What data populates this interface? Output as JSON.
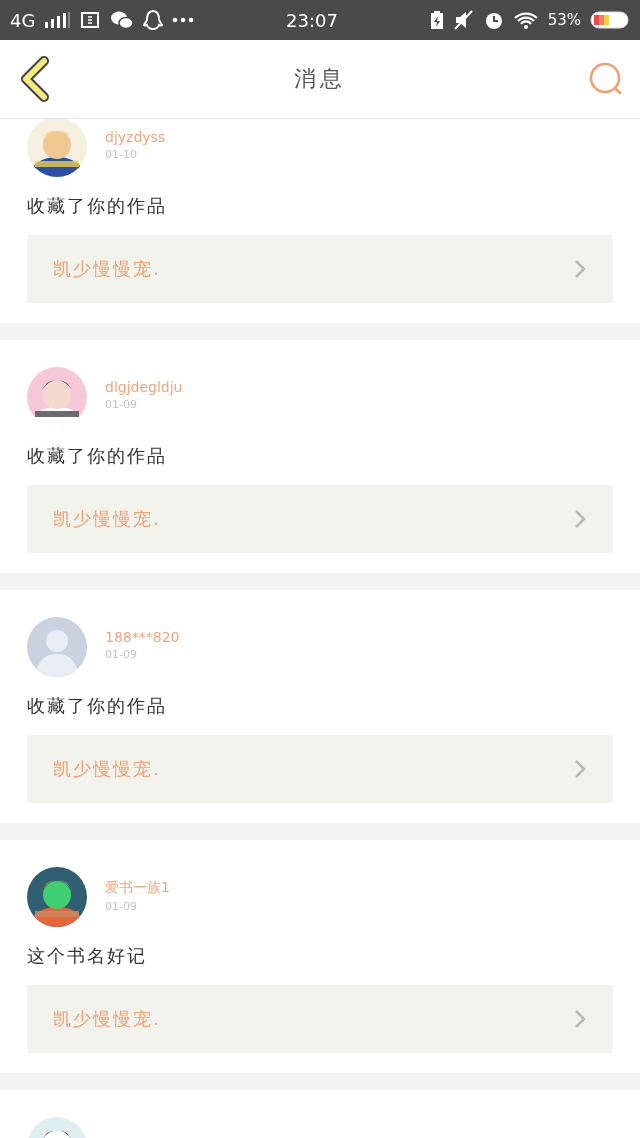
{
  "status_bar": {
    "network": "4G",
    "time": "23:07",
    "battery": "53%"
  },
  "header": {
    "title": "消息"
  },
  "messages": [
    {
      "avatar": {
        "kind": "picture"
      },
      "user": "djyzdyss",
      "date": "01-10",
      "text": "收藏了你的作品",
      "work": "凯少慢慢宠."
    },
    {
      "avatar": {
        "kind": "picture"
      },
      "user": "dlgjdegldju",
      "date": "01-09",
      "text": "收藏了你的作品",
      "work": "凯少慢慢宠."
    },
    {
      "avatar": {
        "kind": "default"
      },
      "user": "188***820",
      "date": "01-09",
      "text": "收藏了你的作品",
      "work": "凯少慢慢宠."
    },
    {
      "avatar": {
        "kind": "picture"
      },
      "user": "爱书一族1",
      "date": "01-09",
      "text": "这个书名好记",
      "work": "凯少慢慢宠."
    },
    {
      "avatar": {
        "kind": "picture"
      }
    }
  ]
}
